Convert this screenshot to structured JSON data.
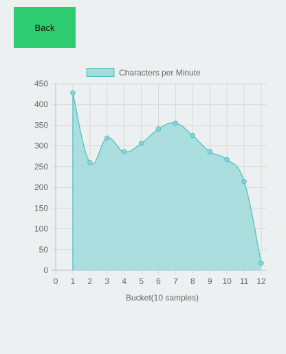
{
  "back_button": {
    "label": "Back"
  },
  "chart_data": {
    "type": "area",
    "title": "",
    "xlabel": "Bucket(10 samples)",
    "ylabel": "",
    "x": [
      1,
      2,
      3,
      4,
      5,
      6,
      7,
      8,
      9,
      10,
      11,
      12
    ],
    "series": [
      {
        "name": "Characters per Minute",
        "values": [
          428,
          260,
          319,
          286,
          306,
          341,
          355,
          325,
          286,
          267,
          214,
          17
        ]
      }
    ],
    "xlim": [
      0,
      12
    ],
    "ylim": [
      0,
      450
    ],
    "xticks": [
      0,
      1,
      2,
      3,
      4,
      5,
      6,
      7,
      8,
      9,
      10,
      11,
      12
    ],
    "yticks": [
      0,
      50,
      100,
      150,
      200,
      250,
      300,
      350,
      400,
      450
    ],
    "grid": true,
    "legend_position": "top",
    "colors": {
      "fill": "#a8dcdc",
      "stroke": "#4cbfbf",
      "grid": "#d8d8d8"
    }
  }
}
